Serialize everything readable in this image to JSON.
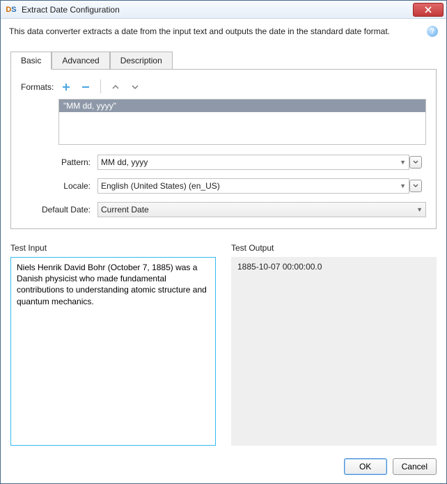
{
  "window": {
    "app_icon_letters": {
      "d": "D",
      "s": "S"
    },
    "title": "Extract Date Configuration"
  },
  "description": "This data converter extracts a date from the input text and outputs the date in the standard date format.",
  "tabs": [
    {
      "label": "Basic"
    },
    {
      "label": "Advanced"
    },
    {
      "label": "Description"
    }
  ],
  "formats": {
    "label": "Formats:",
    "items": [
      {
        "text": "\"MM dd, yyyy\""
      }
    ]
  },
  "fields": {
    "pattern": {
      "label": "Pattern:",
      "value": "MM dd, yyyy"
    },
    "locale": {
      "label": "Locale:",
      "value": "English (United States) (en_US)"
    },
    "default_date": {
      "label": "Default Date:",
      "value": "Current Date"
    }
  },
  "test": {
    "input_label": "Test Input",
    "input_value": "Niels Henrik David Bohr (October 7, 1885) was a Danish physicist who made fundamental contributions to understanding atomic structure and quantum mechanics.",
    "output_label": "Test Output",
    "output_value": "1885-10-07 00:00:00.0"
  },
  "buttons": {
    "ok": "OK",
    "cancel": "Cancel"
  },
  "icons": {
    "help_glyph": "?"
  }
}
